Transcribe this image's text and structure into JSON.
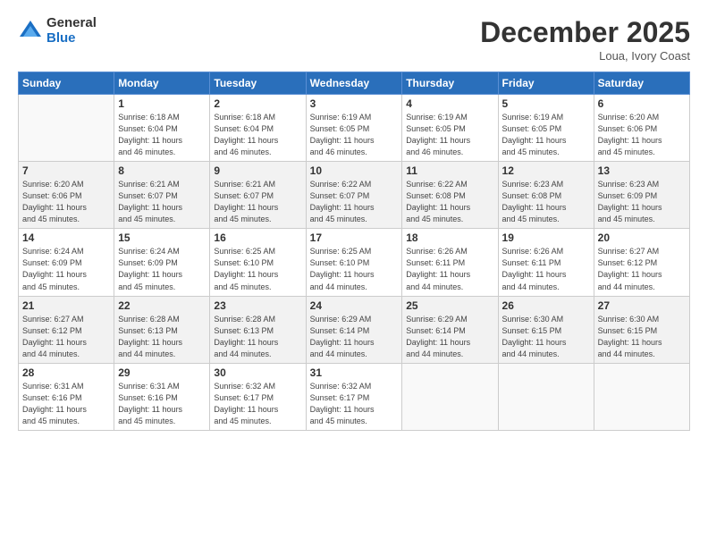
{
  "logo": {
    "general": "General",
    "blue": "Blue"
  },
  "title": "December 2025",
  "subtitle": "Loua, Ivory Coast",
  "weekdays": [
    "Sunday",
    "Monday",
    "Tuesday",
    "Wednesday",
    "Thursday",
    "Friday",
    "Saturday"
  ],
  "weeks": [
    [
      {
        "day": "",
        "detail": ""
      },
      {
        "day": "1",
        "detail": "Sunrise: 6:18 AM\nSunset: 6:04 PM\nDaylight: 11 hours\nand 46 minutes."
      },
      {
        "day": "2",
        "detail": "Sunrise: 6:18 AM\nSunset: 6:04 PM\nDaylight: 11 hours\nand 46 minutes."
      },
      {
        "day": "3",
        "detail": "Sunrise: 6:19 AM\nSunset: 6:05 PM\nDaylight: 11 hours\nand 46 minutes."
      },
      {
        "day": "4",
        "detail": "Sunrise: 6:19 AM\nSunset: 6:05 PM\nDaylight: 11 hours\nand 46 minutes."
      },
      {
        "day": "5",
        "detail": "Sunrise: 6:19 AM\nSunset: 6:05 PM\nDaylight: 11 hours\nand 45 minutes."
      },
      {
        "day": "6",
        "detail": "Sunrise: 6:20 AM\nSunset: 6:06 PM\nDaylight: 11 hours\nand 45 minutes."
      }
    ],
    [
      {
        "day": "7",
        "detail": "Sunrise: 6:20 AM\nSunset: 6:06 PM\nDaylight: 11 hours\nand 45 minutes."
      },
      {
        "day": "8",
        "detail": "Sunrise: 6:21 AM\nSunset: 6:07 PM\nDaylight: 11 hours\nand 45 minutes."
      },
      {
        "day": "9",
        "detail": "Sunrise: 6:21 AM\nSunset: 6:07 PM\nDaylight: 11 hours\nand 45 minutes."
      },
      {
        "day": "10",
        "detail": "Sunrise: 6:22 AM\nSunset: 6:07 PM\nDaylight: 11 hours\nand 45 minutes."
      },
      {
        "day": "11",
        "detail": "Sunrise: 6:22 AM\nSunset: 6:08 PM\nDaylight: 11 hours\nand 45 minutes."
      },
      {
        "day": "12",
        "detail": "Sunrise: 6:23 AM\nSunset: 6:08 PM\nDaylight: 11 hours\nand 45 minutes."
      },
      {
        "day": "13",
        "detail": "Sunrise: 6:23 AM\nSunset: 6:09 PM\nDaylight: 11 hours\nand 45 minutes."
      }
    ],
    [
      {
        "day": "14",
        "detail": "Sunrise: 6:24 AM\nSunset: 6:09 PM\nDaylight: 11 hours\nand 45 minutes."
      },
      {
        "day": "15",
        "detail": "Sunrise: 6:24 AM\nSunset: 6:09 PM\nDaylight: 11 hours\nand 45 minutes."
      },
      {
        "day": "16",
        "detail": "Sunrise: 6:25 AM\nSunset: 6:10 PM\nDaylight: 11 hours\nand 45 minutes."
      },
      {
        "day": "17",
        "detail": "Sunrise: 6:25 AM\nSunset: 6:10 PM\nDaylight: 11 hours\nand 44 minutes."
      },
      {
        "day": "18",
        "detail": "Sunrise: 6:26 AM\nSunset: 6:11 PM\nDaylight: 11 hours\nand 44 minutes."
      },
      {
        "day": "19",
        "detail": "Sunrise: 6:26 AM\nSunset: 6:11 PM\nDaylight: 11 hours\nand 44 minutes."
      },
      {
        "day": "20",
        "detail": "Sunrise: 6:27 AM\nSunset: 6:12 PM\nDaylight: 11 hours\nand 44 minutes."
      }
    ],
    [
      {
        "day": "21",
        "detail": "Sunrise: 6:27 AM\nSunset: 6:12 PM\nDaylight: 11 hours\nand 44 minutes."
      },
      {
        "day": "22",
        "detail": "Sunrise: 6:28 AM\nSunset: 6:13 PM\nDaylight: 11 hours\nand 44 minutes."
      },
      {
        "day": "23",
        "detail": "Sunrise: 6:28 AM\nSunset: 6:13 PM\nDaylight: 11 hours\nand 44 minutes."
      },
      {
        "day": "24",
        "detail": "Sunrise: 6:29 AM\nSunset: 6:14 PM\nDaylight: 11 hours\nand 44 minutes."
      },
      {
        "day": "25",
        "detail": "Sunrise: 6:29 AM\nSunset: 6:14 PM\nDaylight: 11 hours\nand 44 minutes."
      },
      {
        "day": "26",
        "detail": "Sunrise: 6:30 AM\nSunset: 6:15 PM\nDaylight: 11 hours\nand 44 minutes."
      },
      {
        "day": "27",
        "detail": "Sunrise: 6:30 AM\nSunset: 6:15 PM\nDaylight: 11 hours\nand 44 minutes."
      }
    ],
    [
      {
        "day": "28",
        "detail": "Sunrise: 6:31 AM\nSunset: 6:16 PM\nDaylight: 11 hours\nand 45 minutes."
      },
      {
        "day": "29",
        "detail": "Sunrise: 6:31 AM\nSunset: 6:16 PM\nDaylight: 11 hours\nand 45 minutes."
      },
      {
        "day": "30",
        "detail": "Sunrise: 6:32 AM\nSunset: 6:17 PM\nDaylight: 11 hours\nand 45 minutes."
      },
      {
        "day": "31",
        "detail": "Sunrise: 6:32 AM\nSunset: 6:17 PM\nDaylight: 11 hours\nand 45 minutes."
      },
      {
        "day": "",
        "detail": ""
      },
      {
        "day": "",
        "detail": ""
      },
      {
        "day": "",
        "detail": ""
      }
    ]
  ]
}
